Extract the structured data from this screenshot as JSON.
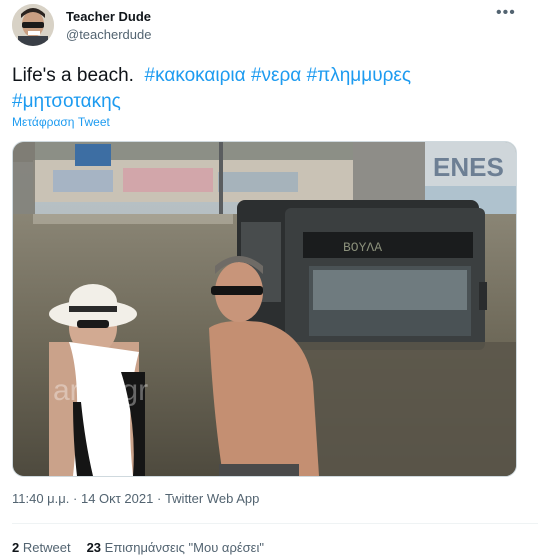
{
  "author": {
    "display_name": "Teacher Dude",
    "handle": "@teacherdude"
  },
  "more_label": "•••",
  "tweet": {
    "text": "Life's a beach.",
    "hashtags": [
      "#κακοκαιρια",
      "#νερα",
      "#πλημμυρες",
      "#μητσοτακης"
    ],
    "translate_label": "Μετάφραση Tweet"
  },
  "media": {
    "watermark": "arpo.gr",
    "bus_sign": "ΒΟΥΛΑ",
    "wall_graffiti": "ENES"
  },
  "meta": {
    "time": "11:40 μ.μ.",
    "separator": "·",
    "date": "14 Οκτ 2021",
    "source": "Twitter Web App"
  },
  "stats": {
    "retweets_count": "2",
    "retweets_label": "Retweet",
    "quotes_count": "23",
    "quotes_label": "Επισημάνσεις \"Μου αρέσει\""
  }
}
